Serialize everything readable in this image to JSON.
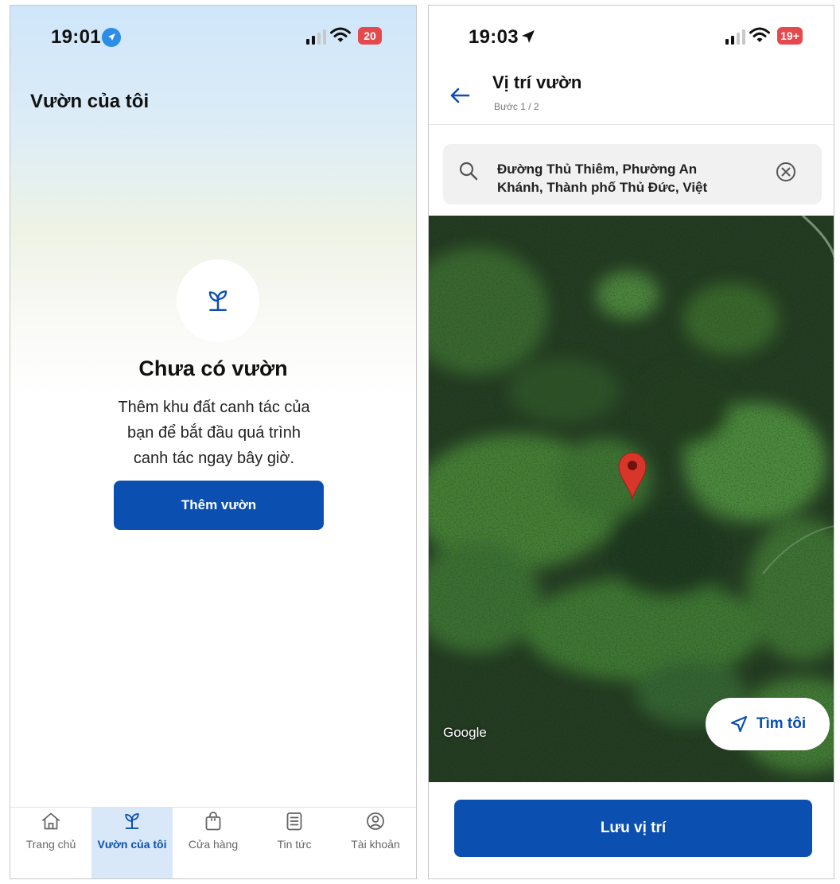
{
  "colors": {
    "primary": "#0b4fb0",
    "tab_active_bg": "#d8e8f8",
    "battery_left": "#e5484d",
    "battery_right": "#e5484d"
  },
  "left": {
    "status": {
      "time": "19:01",
      "battery": "20"
    },
    "page_title": "Vườn của tôi",
    "empty": {
      "icon": "sprout-icon",
      "title": "Chưa có vườn",
      "desc_line1": "Thêm khu đất canh tác của",
      "desc_line2": "bạn để bắt đầu quá trình",
      "desc_line3": "canh tác ngay bây giờ."
    },
    "add_button": "Thêm vườn",
    "tabs": [
      {
        "label": "Trang chủ",
        "icon": "home-icon",
        "active": false
      },
      {
        "label": "Vườn của tôi",
        "icon": "sprout-icon",
        "active": true
      },
      {
        "label": "Cửa hàng",
        "icon": "shopping-bag-icon",
        "active": false
      },
      {
        "label": "Tin tức",
        "icon": "news-icon",
        "active": false
      },
      {
        "label": "Tài khoản",
        "icon": "account-icon",
        "active": false
      }
    ]
  },
  "right": {
    "status": {
      "time": "19:03",
      "battery": "19+"
    },
    "header": {
      "title": "Vị trí vườn",
      "subtitle": "Bước 1 / 2"
    },
    "search": {
      "value_line1": "Đường Thủ Thiêm, Phường An",
      "value_line2": "Khánh, Thành phố Thủ Đức, Việt"
    },
    "map": {
      "attribution": "Google",
      "find_me": "Tìm tôi"
    },
    "save_button": "Lưu vị trí"
  }
}
